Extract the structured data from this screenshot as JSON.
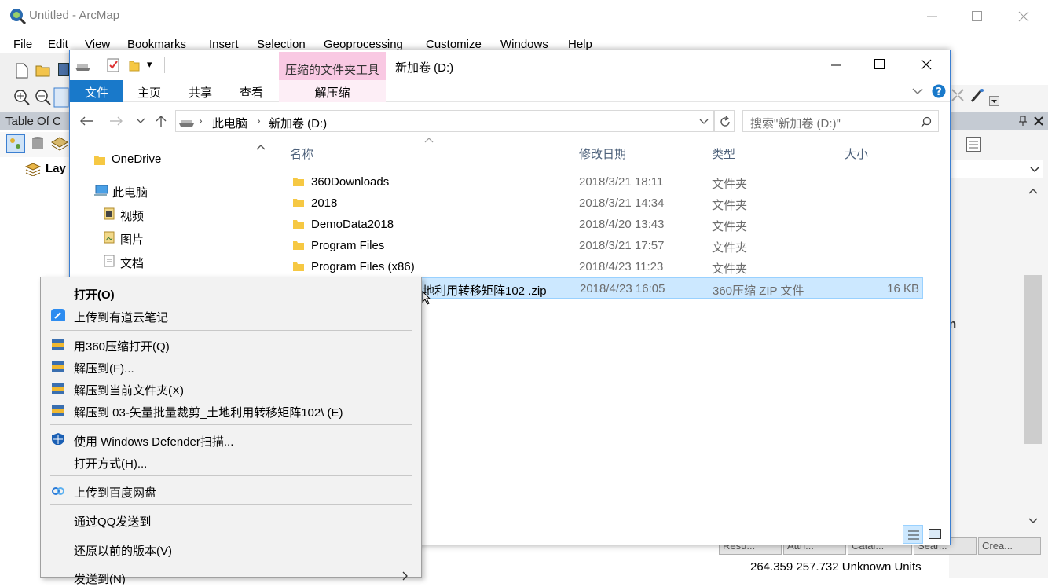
{
  "arcmap": {
    "title": "Untitled - ArcMap",
    "menu": [
      "File",
      "Edit",
      "View",
      "Bookmarks",
      "Insert",
      "Selection",
      "Geoprocessing",
      "Customize",
      "Windows",
      "Help"
    ],
    "toc_title": "Table Of C",
    "toc_layers": "Lay",
    "right_letter": "n",
    "bottom_tabs": [
      "Resu...",
      "Attri...",
      "Catal...",
      "Sear...",
      "Crea..."
    ],
    "status": "264.359  257.732 Unknown Units"
  },
  "explorer": {
    "qat_dropdown": "▾",
    "context_tab_header": "压缩的文件夹工具",
    "window_title": "新加卷 (D:)",
    "ribbon_tabs": [
      "文件",
      "主页",
      "共享",
      "查看"
    ],
    "context_subtab": "解压缩",
    "address": {
      "root": "此电脑",
      "current": "新加卷 (D:)"
    },
    "search_placeholder": "搜索\"新加卷 (D:)\"",
    "nav": [
      "OneDrive",
      "此电脑",
      "视频",
      "图片",
      "文档"
    ],
    "columns": {
      "name": "名称",
      "date": "修改日期",
      "type": "类型",
      "size": "大小"
    },
    "files": [
      {
        "name": "360Downloads",
        "date": "2018/3/21 18:11",
        "type": "文件夹",
        "size": ""
      },
      {
        "name": "2018",
        "date": "2018/3/21 14:34",
        "type": "文件夹",
        "size": ""
      },
      {
        "name": "DemoData2018",
        "date": "2018/4/20 13:43",
        "type": "文件夹",
        "size": ""
      },
      {
        "name": "Program Files",
        "date": "2018/3/21 17:57",
        "type": "文件夹",
        "size": ""
      },
      {
        "name": "Program Files (x86)",
        "date": "2018/4/23 11:23",
        "type": "文件夹",
        "size": ""
      },
      {
        "name": "地利用转移矩阵102 .zip",
        "date": "2018/4/23 16:05",
        "type": "360压缩 ZIP 文件",
        "size": "16 KB"
      }
    ]
  },
  "context_menu": {
    "items": [
      "打开(O)",
      "上传到有道云笔记",
      "用360压缩打开(Q)",
      "解压到(F)...",
      "解压到当前文件夹(X)",
      "解压到 03-矢量批量裁剪_土地利用转移矩阵102\\ (E)",
      "使用 Windows Defender扫描...",
      "打开方式(H)...",
      "上传到百度网盘",
      "通过QQ发送到",
      "还原以前的版本(V)",
      "发送到(N)"
    ]
  }
}
